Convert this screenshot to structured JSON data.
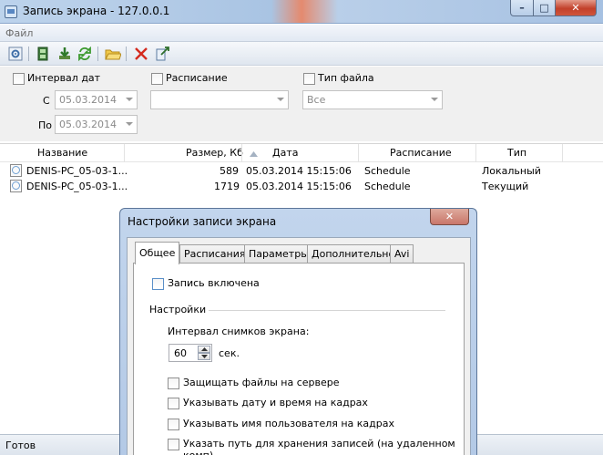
{
  "window": {
    "title": "Запись экрана - 127.0.0.1",
    "min": "–",
    "max": "□",
    "close": "✕"
  },
  "menu": {
    "file": "Файл"
  },
  "toolbar": {
    "icons": [
      "settings-icon",
      "film-icon",
      "download-icon",
      "refresh-icon",
      "folder-icon",
      "delete-icon",
      "export-icon"
    ]
  },
  "filters": {
    "date_interval_label": "Интервал дат",
    "schedule_label": "Расписание",
    "file_type_label": "Тип файла",
    "from_label": "С",
    "to_label": "По",
    "from_value": "05.03.2014",
    "to_value": "05.03.2014",
    "schedule_value": "",
    "file_type_value": "Все"
  },
  "list": {
    "columns": [
      "Название",
      "Размер, Кб",
      "Дата",
      "Расписание",
      "Тип"
    ],
    "rows": [
      {
        "name": "DENIS-PC_05-03-1...",
        "size": "589",
        "date": "05.03.2014 15:15:06",
        "schedule": "Schedule",
        "type": "Локальный"
      },
      {
        "name": "DENIS-PC_05-03-1...",
        "size": "1719",
        "date": "05.03.2014 15:15:06",
        "schedule": "Schedule",
        "type": "Текущий"
      }
    ]
  },
  "status": {
    "text": "Готов"
  },
  "dialog": {
    "title": "Настройки записи экрана",
    "close": "✕",
    "tabs": [
      "Общее",
      "Расписания",
      "Параметры",
      "Дополнительно",
      "Avi"
    ],
    "recording_enabled": "Запись включена",
    "settings_group": "Настройки",
    "interval_label": "Интервал снимков экрана:",
    "interval_value": "60",
    "interval_unit": "сек.",
    "options": [
      "Защищать файлы на сервере",
      "Указывать дату и время на кадрах",
      "Указывать имя пользователя на кадрах",
      "Указать путь для хранения записей (на удаленном комп)"
    ]
  }
}
